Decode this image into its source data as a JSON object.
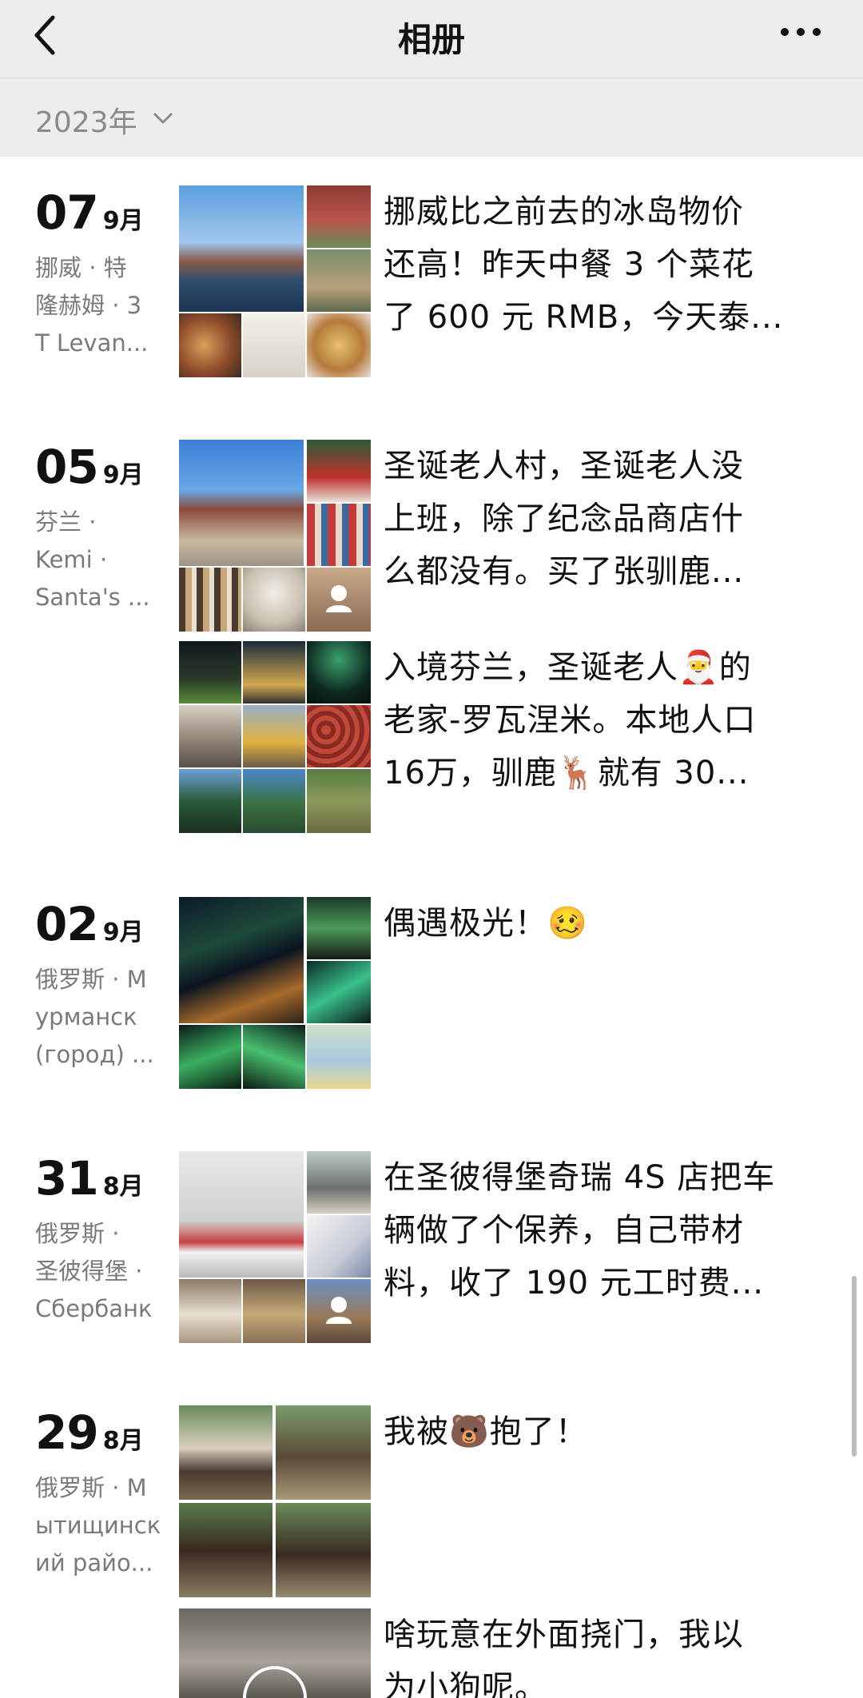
{
  "header": {
    "title": "相册",
    "back_icon": "chevron-left-icon",
    "more_icon": "ellipsis-icon"
  },
  "year_selector": {
    "label": "2023年",
    "icon": "chevron-down-icon"
  },
  "posts": [
    {
      "day": "07",
      "month": "9月",
      "location_lines": [
        "挪威 · 特",
        "隆赫姆 · 3",
        "T Levan..."
      ],
      "text_lines": [
        "挪威比之前去的冰岛物价",
        "还高！昨天中餐 3 个菜花",
        "了 600 元 RMB，今天泰..."
      ]
    },
    {
      "day": "05",
      "month": "9月",
      "location_lines": [
        "芬兰 ·",
        "Kemi ·",
        "Santa's ..."
      ],
      "text_lines": [
        "圣诞老人村，圣诞老人没",
        "上班，除了纪念品商店什",
        "么都没有。买了张驯鹿..."
      ],
      "second_text_lines": [
        "入境芬兰，圣诞老人🎅的",
        "老家-罗瓦涅米。本地人口",
        "16万，驯鹿🦌就有 30..."
      ]
    },
    {
      "day": "02",
      "month": "9月",
      "location_lines": [
        "俄罗斯 · M",
        "урманск",
        "(город) ..."
      ],
      "text_lines": [
        "偶遇极光！🥴"
      ]
    },
    {
      "day": "31",
      "month": "8月",
      "location_lines": [
        "俄罗斯 ·",
        "圣彼得堡 ·",
        "Сбербанк"
      ],
      "text_lines": [
        "在圣彼得堡奇瑞 4S 店把车",
        "辆做了个保养，自己带材",
        "料，收了 190 元工时费..."
      ]
    },
    {
      "day": "29",
      "month": "8月",
      "location_lines": [
        "俄罗斯 · М",
        "ытищинск",
        "ий райо..."
      ],
      "text_lines": [
        "我被🐻抱了！"
      ],
      "second_text_lines": [
        "啥玩意在外面挠门，我以",
        "为小狗呢。"
      ]
    }
  ],
  "colors": {
    "nav_bg": "#ededed",
    "secondary_text": "#7a7a7a",
    "primary_text": "#111111"
  }
}
